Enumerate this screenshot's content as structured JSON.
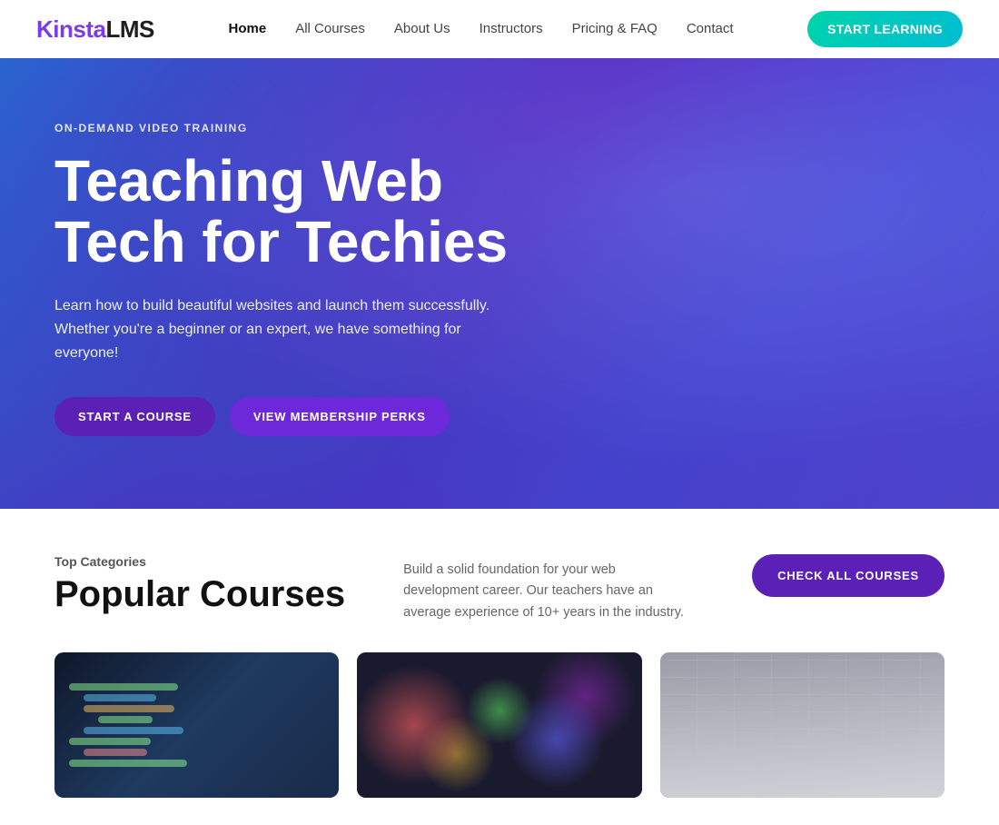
{
  "brand": {
    "kinsta": "Kinsta",
    "lms": "LMS"
  },
  "navbar": {
    "links": [
      {
        "label": "Home",
        "active": true
      },
      {
        "label": "All Courses",
        "active": false
      },
      {
        "label": "About Us",
        "active": false
      },
      {
        "label": "Instructors",
        "active": false
      },
      {
        "label": "Pricing & FAQ",
        "active": false
      },
      {
        "label": "Contact",
        "active": false
      }
    ],
    "cta_label": "START LEARNING"
  },
  "hero": {
    "eyebrow": "ON-DEMAND VIDEO TRAINING",
    "title_line1": "Teaching Web",
    "title_line2": "Tech for Techies",
    "subtitle": "Learn how to build beautiful websites and launch them successfully. Whether you're a beginner or an expert, we have something for everyone!",
    "btn_primary": "START A COURSE",
    "btn_secondary": "VIEW MEMBERSHIP PERKS"
  },
  "courses_section": {
    "top_label": "Top Categories",
    "title": "Popular Courses",
    "description": "Build a solid foundation for your web development career. Our teachers have an average experience of 10+ years in the industry.",
    "check_all_btn": "CHECK ALL COURSES",
    "cards": [
      {
        "id": "card-1",
        "type": "code"
      },
      {
        "id": "card-2",
        "type": "bokeh"
      },
      {
        "id": "card-3",
        "type": "design"
      }
    ]
  }
}
